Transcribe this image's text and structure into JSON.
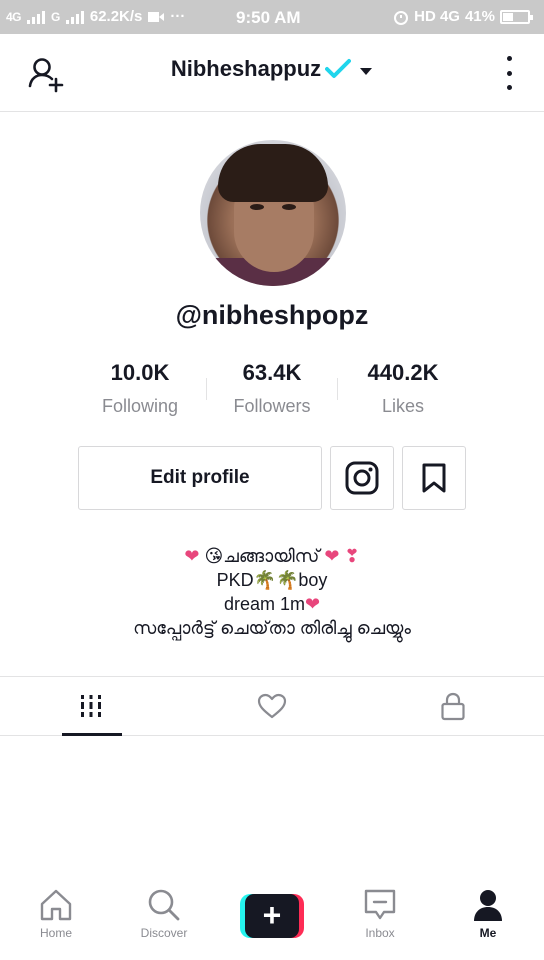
{
  "status_bar": {
    "signal_1": "4G",
    "signal_2": "G",
    "speed": "62.2K/s",
    "time": "9:50 AM",
    "network": "HD 4G",
    "battery": "41%",
    "battery_level": 0.41
  },
  "header": {
    "username": "Nibheshappuz"
  },
  "profile": {
    "handle": "@nibheshpopz"
  },
  "stats": [
    {
      "value": "10.0K",
      "label": "Following"
    },
    {
      "value": "63.4K",
      "label": "Followers"
    },
    {
      "value": "440.2K",
      "label": "Likes"
    }
  ],
  "actions": {
    "edit_profile": "Edit profile"
  },
  "bio": {
    "line1_text": "ചങ്ങായിസ്",
    "line2_a": "PKD",
    "line2_b": "boy",
    "line3": "dream 1m",
    "line4": "സപ്പോർട്ട് ചെയ്‌താ തിരിച്ചു ചെയ്യും"
  },
  "bottom_nav": {
    "home": "Home",
    "discover": "Discover",
    "inbox": "Inbox",
    "me": "Me",
    "create": "+"
  },
  "colors": {
    "accent_check": "#20d5ec",
    "heart": "#e8467c",
    "create_cyan": "#25f4ee",
    "create_red": "#fe2c55"
  }
}
